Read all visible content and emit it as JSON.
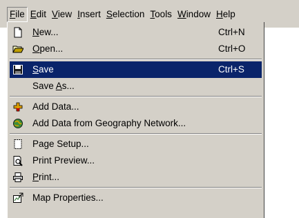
{
  "menubar": {
    "items": [
      {
        "pre": "",
        "key": "F",
        "post": "ile"
      },
      {
        "pre": "",
        "key": "E",
        "post": "dit"
      },
      {
        "pre": "",
        "key": "V",
        "post": "iew"
      },
      {
        "pre": "",
        "key": "I",
        "post": "nsert"
      },
      {
        "pre": "",
        "key": "S",
        "post": "election"
      },
      {
        "pre": "",
        "key": "T",
        "post": "ools"
      },
      {
        "pre": "",
        "key": "W",
        "post": "indow"
      },
      {
        "pre": "",
        "key": "H",
        "post": "elp"
      }
    ]
  },
  "file_menu": {
    "items": [
      {
        "pre": "",
        "key": "N",
        "post": "ew...",
        "shortcut": "Ctrl+N",
        "icon": "new-document-icon"
      },
      {
        "pre": "",
        "key": "O",
        "post": "pen...",
        "shortcut": "Ctrl+O",
        "icon": "open-folder-icon"
      },
      {
        "pre": "",
        "key": "S",
        "post": "ave",
        "shortcut": "Ctrl+S",
        "icon": "save-disk-icon"
      },
      {
        "pre": "Save ",
        "key": "A",
        "post": "s...",
        "shortcut": "",
        "icon": ""
      },
      {
        "pre": "Add Data...",
        "key": "",
        "post": "",
        "shortcut": "",
        "icon": "add-data-icon"
      },
      {
        "pre": "Add Data from Geography Network...",
        "key": "",
        "post": "",
        "shortcut": "",
        "icon": "geography-network-icon"
      },
      {
        "pre": "Page Setup...",
        "key": "",
        "post": "",
        "shortcut": "",
        "icon": "page-setup-icon"
      },
      {
        "pre": "Print Preview...",
        "key": "",
        "post": "",
        "shortcut": "",
        "icon": "print-preview-icon"
      },
      {
        "pre": "",
        "key": "P",
        "post": "rint...",
        "shortcut": "",
        "icon": "printer-icon"
      },
      {
        "pre": "Map Properties...",
        "key": "",
        "post": "",
        "shortcut": "",
        "icon": "map-properties-icon"
      }
    ]
  },
  "colors": {
    "menu_background": "#d4d0c8",
    "selection_background": "#0a246a",
    "selection_text": "#ffffff"
  }
}
